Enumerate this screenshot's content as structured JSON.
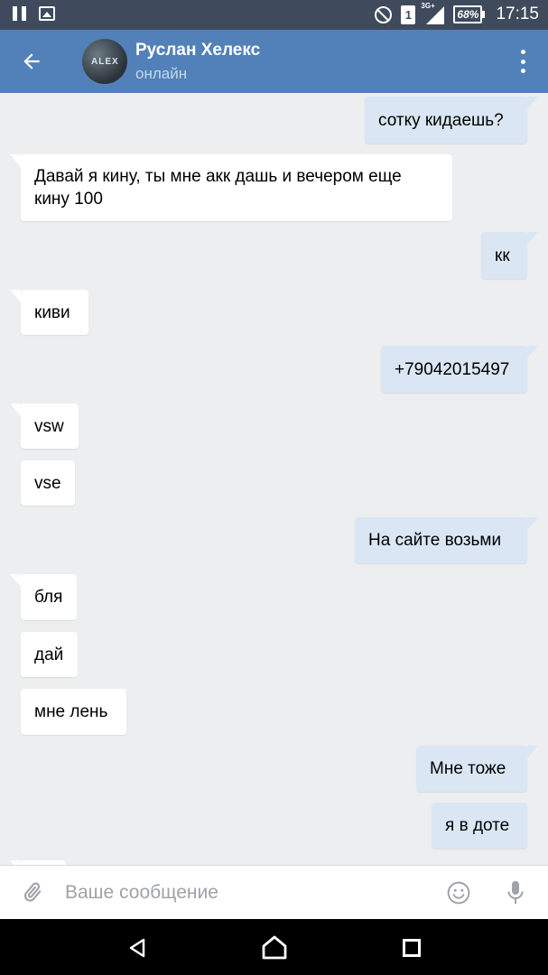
{
  "status_bar": {
    "time": "17:15",
    "battery": "68%",
    "network": "3G+",
    "sim": "1",
    "icons": [
      "pause-icon",
      "gallery-icon",
      "do-not-disturb-icon",
      "sim-icon",
      "signal-icon",
      "battery-icon"
    ]
  },
  "header": {
    "contact_name": "Руслан Хелекс",
    "status": "онлайн",
    "avatar_mark": "ALEX",
    "accent_color": "#5181b8"
  },
  "messages": [
    {
      "side": "out",
      "lines": [
        "сотку кидаешь?"
      ]
    },
    {
      "side": "in",
      "lines": [
        "Давай я кину, ты мне акк дашь и вечером еще",
        "кину 100"
      ]
    },
    {
      "side": "out",
      "lines": [
        "кк"
      ]
    },
    {
      "side": "in",
      "lines": [
        "киви"
      ]
    },
    {
      "side": "out",
      "lines": [
        "+79042015497"
      ]
    },
    {
      "side": "in",
      "lines": [
        "vsw"
      ]
    },
    {
      "side": "in",
      "lines": [
        "vse"
      ]
    },
    {
      "side": "out",
      "lines": [
        "На сайте возьми"
      ]
    },
    {
      "side": "in",
      "lines": [
        "бля"
      ]
    },
    {
      "side": "in",
      "lines": [
        "дай"
      ]
    },
    {
      "side": "in",
      "lines": [
        "мне лень"
      ]
    },
    {
      "side": "out",
      "lines": [
        "Мне тоже"
      ]
    },
    {
      "side": "out",
      "lines": [
        "я в доте"
      ]
    }
  ],
  "composer": {
    "placeholder": "Ваше сообщение"
  },
  "colors": {
    "incoming_bubble": "#ffffff",
    "outgoing_bubble": "#dae6f3",
    "background": "#edeef0"
  }
}
